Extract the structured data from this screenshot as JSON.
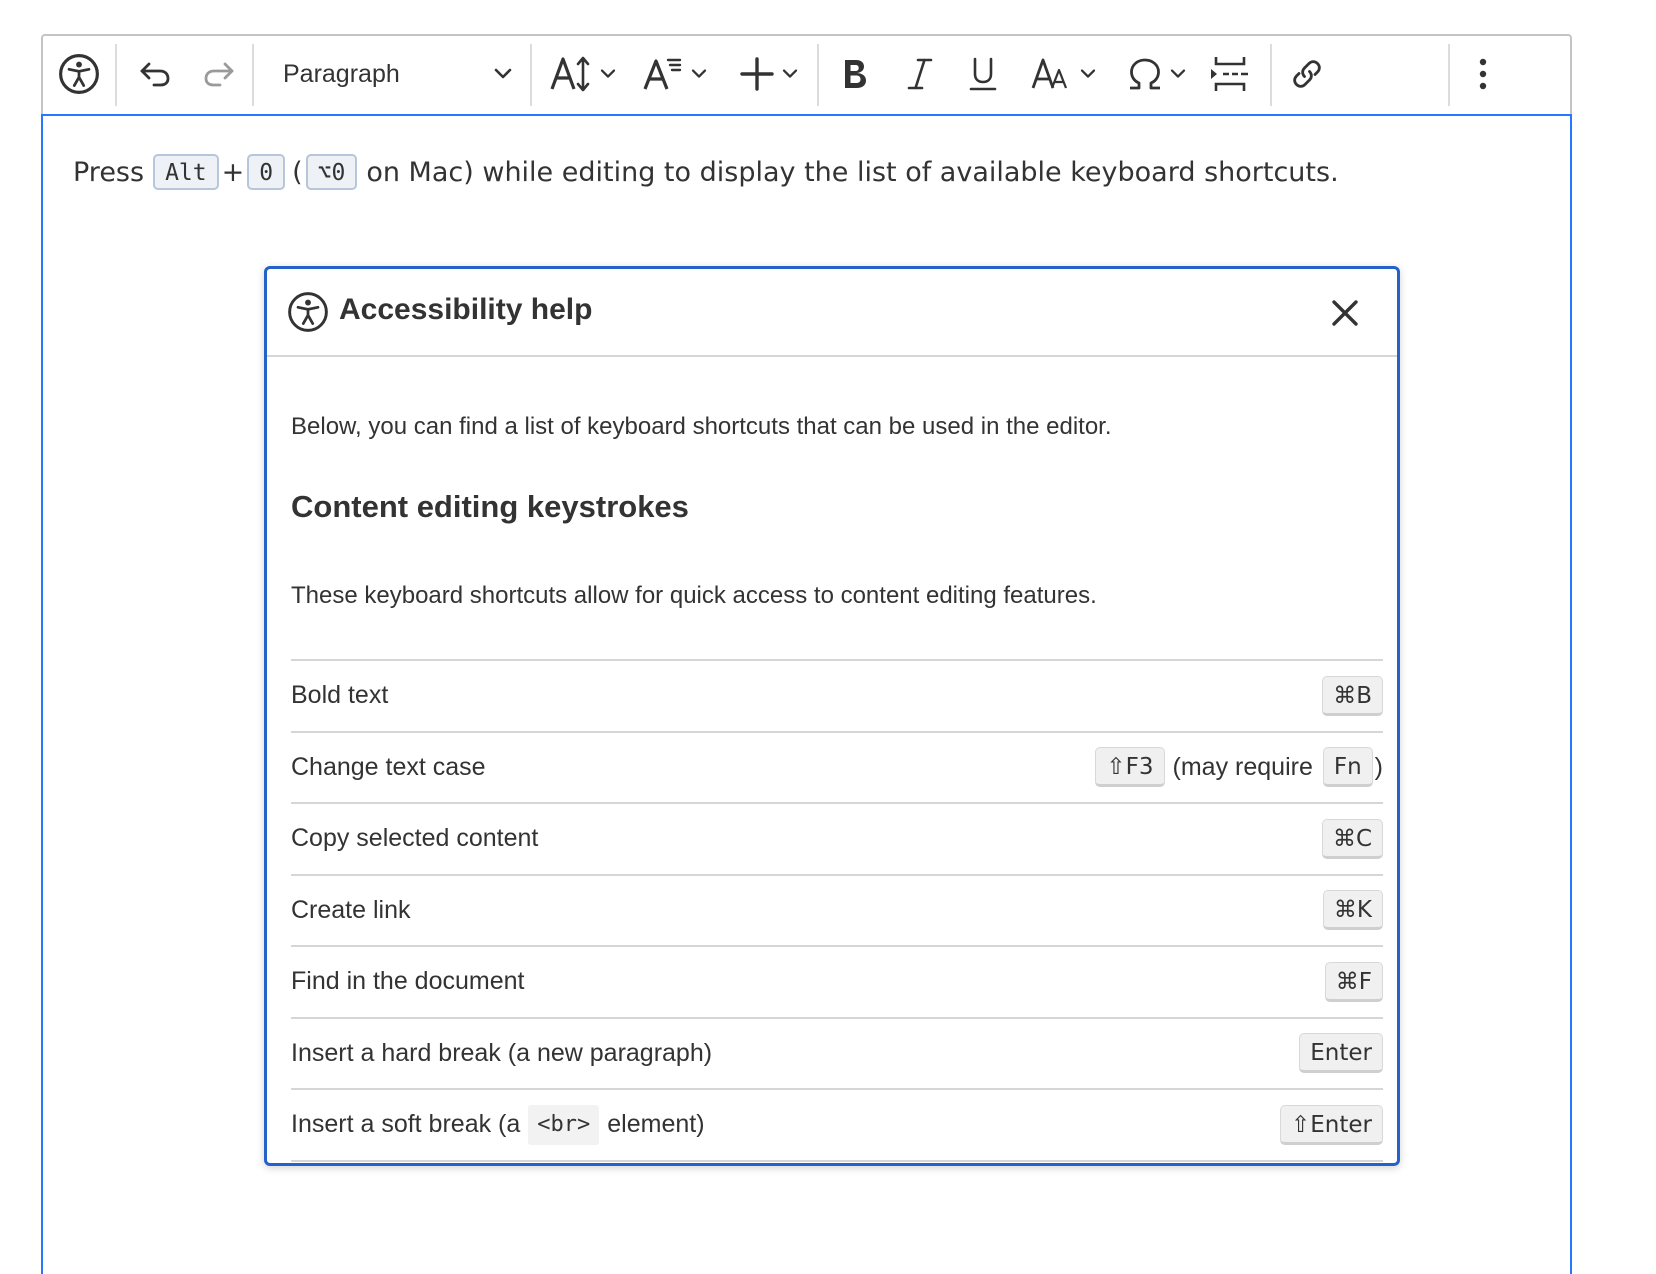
{
  "toolbar": {
    "paragraph_label": "Paragraph",
    "buttons": [
      {
        "name": "accessibility-icon"
      },
      {
        "name": "undo-icon"
      },
      {
        "name": "redo-icon"
      },
      {
        "name": "font-size-icon"
      },
      {
        "name": "font-family-icon"
      },
      {
        "name": "insert-icon"
      },
      {
        "name": "bold-icon"
      },
      {
        "name": "italic-icon"
      },
      {
        "name": "underline-icon"
      },
      {
        "name": "text-case-icon"
      },
      {
        "name": "special-characters-icon"
      },
      {
        "name": "page-break-icon"
      },
      {
        "name": "link-icon"
      },
      {
        "name": "more-icon"
      }
    ]
  },
  "editor": {
    "press": "Press",
    "key_alt": "Alt",
    "plus": "+",
    "key_zero": "0",
    "open_paren": "(",
    "key_mac": "⌥0",
    "rest": "on Mac) while editing to display the list of available keyboard shortcuts."
  },
  "dialog": {
    "title": "Accessibility help",
    "intro": "Below, you can find a list of keyboard shortcuts that can be used in the editor.",
    "section_title": "Content editing keystrokes",
    "section_desc": "These keyboard shortcuts allow for quick access to content editing features.",
    "shortcuts": [
      {
        "label": "Bold text",
        "key": "⌘B"
      },
      {
        "label": "Change text case",
        "key": "⇧F3",
        "note": "(may require",
        "extra_key": "Fn",
        "close": ")"
      },
      {
        "label": "Copy selected content",
        "key": "⌘C"
      },
      {
        "label": "Create link",
        "key": "⌘K"
      },
      {
        "label": "Find in the document",
        "key": "⌘F"
      },
      {
        "label": "Insert a hard break (a new paragraph)",
        "key": "Enter"
      },
      {
        "label_pre": "Insert a soft break (a",
        "code": "<br>",
        "label_post": "element)",
        "key": "⇧Enter"
      }
    ]
  },
  "colors": {
    "accent": "#2977ff",
    "dialog_border": "#2462c9",
    "kbd_bg": "#eef2f7",
    "key_bg": "#f0f0f0"
  }
}
